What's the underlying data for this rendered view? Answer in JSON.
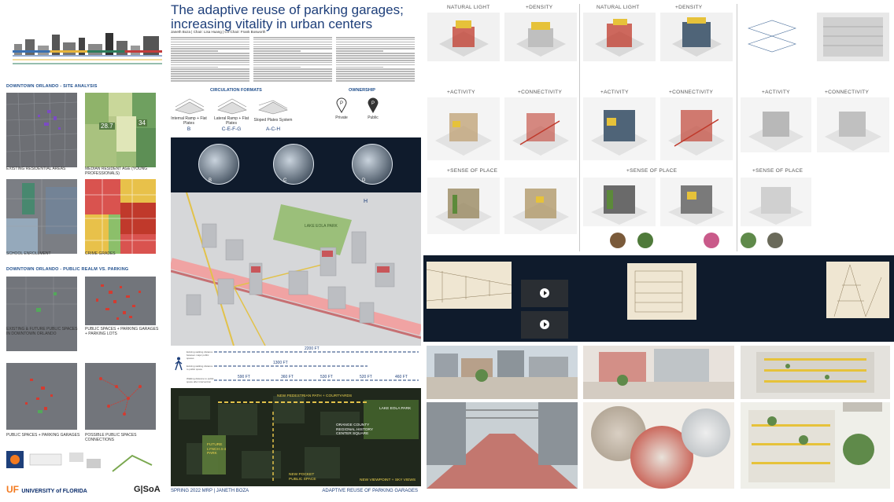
{
  "title": "The adaptive reuse of parking garages; increasing vitality in urban centers",
  "title_line1": "The adaptive reuse of parking garages;",
  "title_line2": "increasing vitality in urban centers",
  "authors": "Janeth Boza | Chair: Lisa Huang | Co-Chair: Frank Bosworth",
  "site_analysis": {
    "heading": "DOWNTOWN ORLANDO - SITE ANALYSIS",
    "maps": [
      {
        "label": "EXISTING RESIDENTIAL AREAS"
      },
      {
        "label": "MEDIAN RESIDENT AGE (YOUNG PROFESSIONALS)"
      },
      {
        "label": "SCHOOL ENROLLMENT"
      },
      {
        "label": "CRIME GRADES"
      }
    ],
    "values": [
      "28.7",
      "34"
    ]
  },
  "public_realm": {
    "heading": "DOWNTOWN ORLANDO - PUBLIC REALM VS. PARKING",
    "maps": [
      {
        "label": "EXISTING & FUTURE PUBLIC SPACES IN DOWNTOWN ORLANDO"
      },
      {
        "label": "PUBLIC SPACES + PARKING GARAGES + PARKING LOTS"
      },
      {
        "label": "PUBLIC SPACES + PARKING GARAGES"
      },
      {
        "label": "POSSIBLE PUBLIC SPACES CONNECTIONS"
      }
    ]
  },
  "circulation": {
    "heading": "CIRCULATION FORMATS",
    "types": [
      {
        "label": "Internal Ramp + Flat Plates",
        "code": "B"
      },
      {
        "label": "Lateral Ramp + Flat Plates",
        "code": "C-E-F-G"
      },
      {
        "label": "Sloped Plates System",
        "code": "A-C-H"
      }
    ],
    "circle_letters": [
      "B",
      "C",
      "D"
    ]
  },
  "ownership": {
    "heading": "OWNERSHIP",
    "types": [
      {
        "label": "Private",
        "icon": "p-pin-icon"
      },
      {
        "label": "Public",
        "icon": "p-pin-icon"
      }
    ]
  },
  "iso_map": {
    "park_label": "LAKE EOLA PARK",
    "pin_label": "H"
  },
  "walking": {
    "distances": [
      "2200 FT",
      "1300 FT",
      "590 FT",
      "360 FT",
      "530 FT",
      "520 FT",
      "460 FT"
    ],
    "legend": [
      "Existing walking distance between major public spaces",
      "Existing walking distance to public space",
      "Walking distance to public space after intervention"
    ]
  },
  "night_map": {
    "labels": [
      "NEW PEDESTRIAN PATH + COURTYARDS",
      "LAKE EOLA PARK",
      "ORANGE COUNTY REGIONAL HISTORY CENTER SQUARE",
      "FUTURE LYNCH 4-4 PARK",
      "NEW POCKET PUBLIC SPACE",
      "NEW VIEWPOINT + SKY VIEWS"
    ]
  },
  "footer": {
    "left": "SPRING 2022 MRP | JANETH BOZA",
    "right": "ADAPTIVE REUSE OF PARKING GARAGES"
  },
  "logos": {
    "uf_prefix": "UF",
    "uf_name": "UNIVERSITY of FLORIDA",
    "gsoa": "G|SoA"
  },
  "diagram_headings": {
    "row1": [
      "NATURAL LIGHT",
      "+DENSITY",
      "NATURAL LIGHT",
      "+DENSITY"
    ],
    "row2": [
      "+ACTIVITY",
      "+CONNECTIVITY",
      "+ACTIVITY",
      "+CONNECTIVITY",
      "+ACTIVITY",
      "+CONNECTIVITY"
    ],
    "row3": [
      "+SENSE OF PLACE",
      "+SENSE OF PLACE",
      "+SENSE OF PLACE"
    ]
  },
  "colors": {
    "brand_blue": "#1e3f7a",
    "accent_red": "#c0392b",
    "accent_yellow": "#e6c23a",
    "night_bg": "#0f1b2c"
  }
}
